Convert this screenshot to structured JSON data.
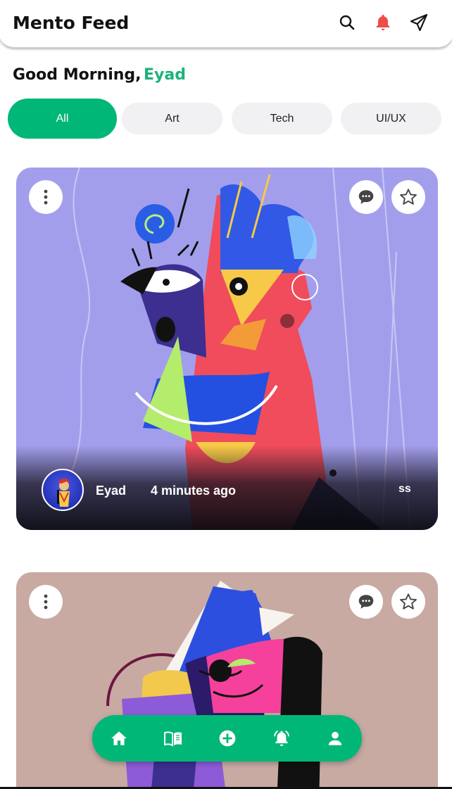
{
  "header": {
    "title": "Mento Feed",
    "icons": [
      "search-icon",
      "bell-icon",
      "send-icon"
    ],
    "bell_color": "#ee4b4b"
  },
  "greeting": {
    "text": "Good Morning,",
    "name": "Eyad",
    "accent_color": "#1bb27a"
  },
  "categories": [
    {
      "label": "All",
      "selected": true
    },
    {
      "label": "Art",
      "selected": false
    },
    {
      "label": "Tech",
      "selected": false
    },
    {
      "label": "UI/UX",
      "selected": false
    }
  ],
  "feed": [
    {
      "author": "Eyad",
      "time": "4 minutes ago",
      "tag": "ss",
      "background": "#a39eec",
      "icons": [
        "more-vertical-icon",
        "comment-icon",
        "star-icon"
      ]
    },
    {
      "background": "#c8aaa3",
      "icons": [
        "more-vertical-icon",
        "comment-icon",
        "star-icon"
      ]
    }
  ],
  "bottom_nav": {
    "items": [
      "home-icon",
      "book-icon",
      "add-icon",
      "alarm-icon",
      "profile-icon"
    ],
    "color": "#00b777"
  }
}
